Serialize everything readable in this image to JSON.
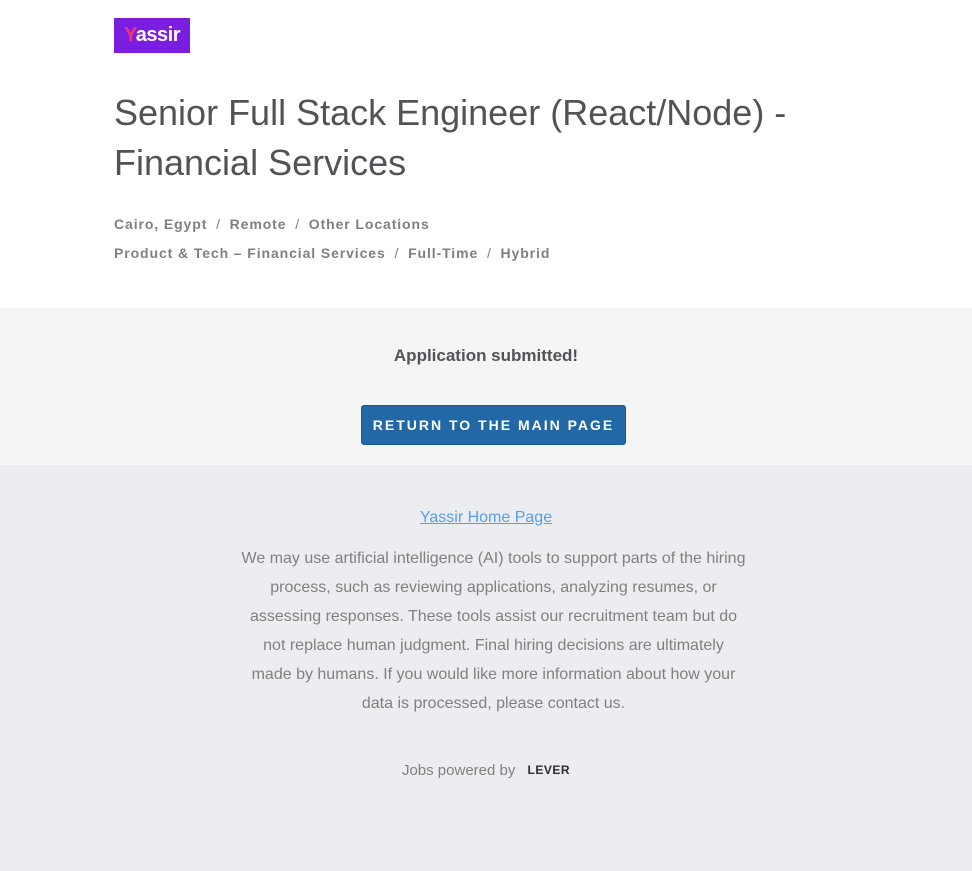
{
  "brand": {
    "logo_initial": "Y",
    "logo_rest": "assir",
    "logo_color": "#7a1fe0",
    "logo_accent": "#ff2e7a"
  },
  "job": {
    "title": "Senior Full Stack Engineer (React/Node) - Financial Services",
    "location": "Cairo, Egypt",
    "location_type": "Remote",
    "other_locations": "Other Locations",
    "team": "Product & Tech – Financial Services",
    "commitment": "Full-Time",
    "workplace": "Hybrid"
  },
  "status": {
    "message": "Application submitted!",
    "return_button": "RETURN TO THE MAIN PAGE",
    "button_color": "#2268a6"
  },
  "footer": {
    "home_link": "Yassir Home Page",
    "ai_notice": "We may use artificial intelligence (AI) tools to support parts of the hiring process, such as reviewing applications, analyzing resumes, or assessing responses. These tools assist our recruitment team but do not replace human judgment. Final hiring decisions are ultimately made by humans. If you would like more information about how your data is processed, please contact us.",
    "powered_by": "Jobs powered by",
    "powered_logo": "LEVER"
  }
}
